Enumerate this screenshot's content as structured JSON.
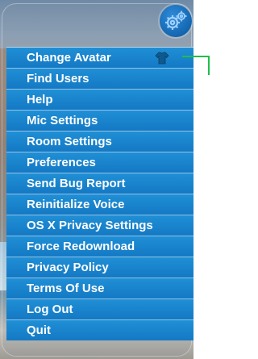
{
  "menu": {
    "items": [
      {
        "label": "Change Avatar",
        "icon": "shirt-icon"
      },
      {
        "label": "Find Users"
      },
      {
        "label": "Help"
      },
      {
        "label": "Mic Settings"
      },
      {
        "label": "Room Settings"
      },
      {
        "label": "Preferences"
      },
      {
        "label": "Send Bug Report"
      },
      {
        "label": "Reinitialize Voice"
      },
      {
        "label": "OS X Privacy Settings"
      },
      {
        "label": "Force Redownload"
      },
      {
        "label": "Privacy Policy"
      },
      {
        "label": "Terms Of Use"
      },
      {
        "label": "Log Out"
      },
      {
        "label": "Quit"
      }
    ]
  },
  "toolbar": {
    "settings_icon": "gears-icon"
  },
  "colors": {
    "menu_item_bg": "#1a86d0",
    "menu_item_text": "#ffffff",
    "gear_button_bg": "#1466b0",
    "pointer_line": "#1fbf4a"
  }
}
